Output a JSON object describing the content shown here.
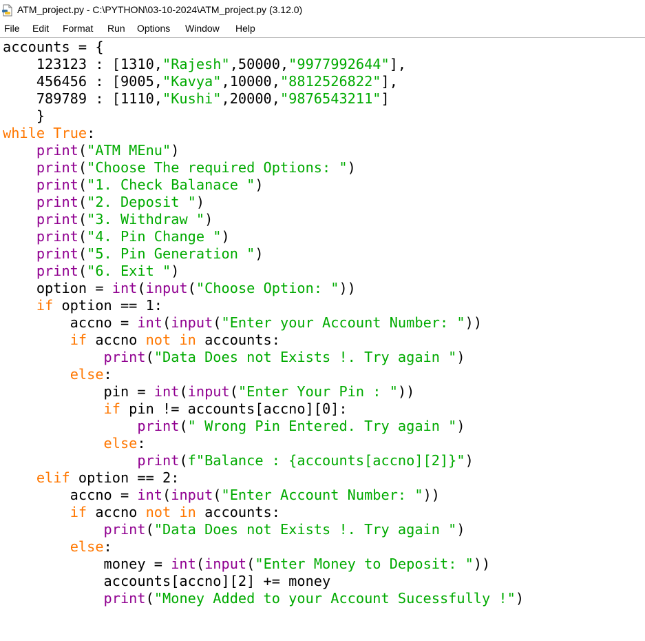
{
  "window": {
    "title": "ATM_project.py - C:\\PYTHON\\03-10-2024\\ATM_project.py (3.12.0)",
    "icon": "python-file-icon"
  },
  "menu": {
    "items": [
      "File",
      "Edit",
      "Format",
      "Run",
      "Options",
      "Window",
      "Help"
    ]
  },
  "colors": {
    "keyword": "#ff7700",
    "builtin": "#900090",
    "string": "#00aa00",
    "default": "#000000"
  },
  "editor": {
    "lines": [
      [
        [
          "df",
          "accounts = {"
        ]
      ],
      [
        [
          "df",
          "    123123 : [1310,"
        ],
        [
          "st",
          "\"Rajesh\""
        ],
        [
          "df",
          ",50000,"
        ],
        [
          "st",
          "\"9977992644\""
        ],
        [
          "df",
          "],"
        ]
      ],
      [
        [
          "df",
          "    456456 : [9005,"
        ],
        [
          "st",
          "\"Kavya\""
        ],
        [
          "df",
          ",10000,"
        ],
        [
          "st",
          "\"8812526822\""
        ],
        [
          "df",
          "],"
        ]
      ],
      [
        [
          "df",
          "    789789 : [1110,"
        ],
        [
          "st",
          "\"Kushi\""
        ],
        [
          "df",
          ",20000,"
        ],
        [
          "st",
          "\"9876543211\""
        ],
        [
          "df",
          "]"
        ]
      ],
      [
        [
          "df",
          "    }"
        ]
      ],
      [
        [
          "kw",
          "while"
        ],
        [
          "df",
          " "
        ],
        [
          "kw",
          "True"
        ],
        [
          "df",
          ":"
        ]
      ],
      [
        [
          "df",
          "    "
        ],
        [
          "bi",
          "print"
        ],
        [
          "df",
          "("
        ],
        [
          "st",
          "\"ATM MEnu\""
        ],
        [
          "df",
          ")"
        ]
      ],
      [
        [
          "df",
          "    "
        ],
        [
          "bi",
          "print"
        ],
        [
          "df",
          "("
        ],
        [
          "st",
          "\"Choose The required Options: \""
        ],
        [
          "df",
          ")"
        ]
      ],
      [
        [
          "df",
          "    "
        ],
        [
          "bi",
          "print"
        ],
        [
          "df",
          "("
        ],
        [
          "st",
          "\"1. Check Balanace \""
        ],
        [
          "df",
          ")"
        ]
      ],
      [
        [
          "df",
          "    "
        ],
        [
          "bi",
          "print"
        ],
        [
          "df",
          "("
        ],
        [
          "st",
          "\"2. Deposit \""
        ],
        [
          "df",
          ")"
        ]
      ],
      [
        [
          "df",
          "    "
        ],
        [
          "bi",
          "print"
        ],
        [
          "df",
          "("
        ],
        [
          "st",
          "\"3. Withdraw \""
        ],
        [
          "df",
          ")"
        ]
      ],
      [
        [
          "df",
          "    "
        ],
        [
          "bi",
          "print"
        ],
        [
          "df",
          "("
        ],
        [
          "st",
          "\"4. Pin Change \""
        ],
        [
          "df",
          ")"
        ]
      ],
      [
        [
          "df",
          "    "
        ],
        [
          "bi",
          "print"
        ],
        [
          "df",
          "("
        ],
        [
          "st",
          "\"5. Pin Generation \""
        ],
        [
          "df",
          ")"
        ]
      ],
      [
        [
          "df",
          "    "
        ],
        [
          "bi",
          "print"
        ],
        [
          "df",
          "("
        ],
        [
          "st",
          "\"6. Exit \""
        ],
        [
          "df",
          ")"
        ]
      ],
      [
        [
          "df",
          "    option = "
        ],
        [
          "bi",
          "int"
        ],
        [
          "df",
          "("
        ],
        [
          "bi",
          "input"
        ],
        [
          "df",
          "("
        ],
        [
          "st",
          "\"Choose Option: \""
        ],
        [
          "df",
          "))"
        ]
      ],
      [
        [
          "df",
          "    "
        ],
        [
          "kw",
          "if"
        ],
        [
          "df",
          " option == 1:"
        ]
      ],
      [
        [
          "df",
          "        accno = "
        ],
        [
          "bi",
          "int"
        ],
        [
          "df",
          "("
        ],
        [
          "bi",
          "input"
        ],
        [
          "df",
          "("
        ],
        [
          "st",
          "\"Enter your Account Number: \""
        ],
        [
          "df",
          "))"
        ]
      ],
      [
        [
          "df",
          "        "
        ],
        [
          "kw",
          "if"
        ],
        [
          "df",
          " accno "
        ],
        [
          "kw",
          "not"
        ],
        [
          "df",
          " "
        ],
        [
          "kw",
          "in"
        ],
        [
          "df",
          " accounts:"
        ]
      ],
      [
        [
          "df",
          "            "
        ],
        [
          "bi",
          "print"
        ],
        [
          "df",
          "("
        ],
        [
          "st",
          "\"Data Does not Exists !. Try again \""
        ],
        [
          "df",
          ")"
        ]
      ],
      [
        [
          "df",
          "        "
        ],
        [
          "kw",
          "else"
        ],
        [
          "df",
          ":"
        ]
      ],
      [
        [
          "df",
          "            pin = "
        ],
        [
          "bi",
          "int"
        ],
        [
          "df",
          "("
        ],
        [
          "bi",
          "input"
        ],
        [
          "df",
          "("
        ],
        [
          "st",
          "\"Enter Your Pin : \""
        ],
        [
          "df",
          "))"
        ]
      ],
      [
        [
          "df",
          "            "
        ],
        [
          "kw",
          "if"
        ],
        [
          "df",
          " pin != accounts[accno][0]:"
        ]
      ],
      [
        [
          "df",
          "                "
        ],
        [
          "bi",
          "print"
        ],
        [
          "df",
          "("
        ],
        [
          "st",
          "\" Wrong Pin Entered. Try again \""
        ],
        [
          "df",
          ")"
        ]
      ],
      [
        [
          "df",
          "            "
        ],
        [
          "kw",
          "else"
        ],
        [
          "df",
          ":"
        ]
      ],
      [
        [
          "df",
          "                "
        ],
        [
          "bi",
          "print"
        ],
        [
          "df",
          "("
        ],
        [
          "st",
          "f\"Balance : {accounts[accno][2]}\""
        ],
        [
          "df",
          ")"
        ]
      ],
      [
        [
          "df",
          "    "
        ],
        [
          "kw",
          "elif"
        ],
        [
          "df",
          " option == 2:"
        ]
      ],
      [
        [
          "df",
          "        accno = "
        ],
        [
          "bi",
          "int"
        ],
        [
          "df",
          "("
        ],
        [
          "bi",
          "input"
        ],
        [
          "df",
          "("
        ],
        [
          "st",
          "\"Enter Account Number: \""
        ],
        [
          "df",
          "))"
        ]
      ],
      [
        [
          "df",
          "        "
        ],
        [
          "kw",
          "if"
        ],
        [
          "df",
          " accno "
        ],
        [
          "kw",
          "not"
        ],
        [
          "df",
          " "
        ],
        [
          "kw",
          "in"
        ],
        [
          "df",
          " accounts:"
        ]
      ],
      [
        [
          "df",
          "            "
        ],
        [
          "bi",
          "print"
        ],
        [
          "df",
          "("
        ],
        [
          "st",
          "\"Data Does not Exists !. Try again \""
        ],
        [
          "df",
          ")"
        ]
      ],
      [
        [
          "df",
          "        "
        ],
        [
          "kw",
          "else"
        ],
        [
          "df",
          ":"
        ]
      ],
      [
        [
          "df",
          "            money = "
        ],
        [
          "bi",
          "int"
        ],
        [
          "df",
          "("
        ],
        [
          "bi",
          "input"
        ],
        [
          "df",
          "("
        ],
        [
          "st",
          "\"Enter Money to Deposit: \""
        ],
        [
          "df",
          "))"
        ]
      ],
      [
        [
          "df",
          "            accounts[accno][2] += money"
        ]
      ],
      [
        [
          "df",
          "            "
        ],
        [
          "bi",
          "print"
        ],
        [
          "df",
          "("
        ],
        [
          "st",
          "\"Money Added to your Account Sucessfully !\""
        ],
        [
          "df",
          ")"
        ]
      ]
    ]
  }
}
